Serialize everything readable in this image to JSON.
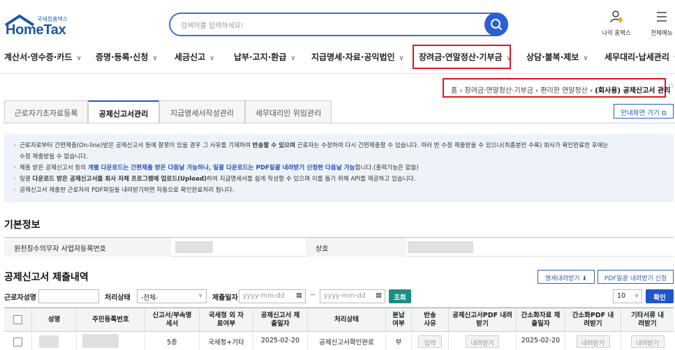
{
  "header": {
    "logo_sub": "국세청홈택스",
    "logo_main": "HomeTax",
    "search_placeholder": "검색어를 입력하세요!",
    "my_hometax": "나의 홈택스",
    "all_menu": "전체메뉴"
  },
  "nav": {
    "items": [
      {
        "label": "계산서·영수증·카드"
      },
      {
        "label": "증명·등록·신청"
      },
      {
        "label": "세금신고"
      },
      {
        "label": "납부·고지·환급"
      },
      {
        "label": "지급명세·자료·공익법인"
      },
      {
        "label": "장려금·연말정산·기부금"
      },
      {
        "label": "상담·불복·제보"
      },
      {
        "label": "세무대리·납세관리"
      }
    ]
  },
  "breadcrumb": {
    "home": "홈",
    "level1": "장려금·연말정산·기부금",
    "level2": "편리한 연말정산",
    "current": "(회사용) 공제신고서 관리"
  },
  "tabs": [
    {
      "label": "근로자기초자료등록"
    },
    {
      "label": "공제신고서관리"
    },
    {
      "label": "지급명세서작성관리"
    },
    {
      "label": "세무대리인 위임관리"
    }
  ],
  "guide_button": "안내화면 가기",
  "notice": {
    "l1a": "근로자로부터 간편제출(On-line)받은 공제신고서 등에 잘못이 있을 경우 그 사유를 기재하여 ",
    "l1b": "반송할 수 있으며",
    "l1c": " 근로자는 수정하여 다시 간편제출할 수 있습니다. 여러 번 수정 제출받을 수 있으나(최종분만 수록) 회사가 확인완료한 후에는",
    "l1d": "수정 제출받을 수 없습니다.",
    "l2a": "제출 받은 공제신고서 등의 ",
    "l2b": "개별 다운로드는 간편제출 받은 다음날 가능하나, 일괄 다운로드는 PDF일괄 내려받기 신청한 다음날 가능",
    "l2c": "합니다.(출력기능은 없음)",
    "l3a": "일괄 ",
    "l3b": "다운로드 받은 공제신고서를 회사 자체 프로그램에 업로드(Upload)",
    "l3c": "하여 지급명세서를 쉽게 작성할 수 있으며 이를 돕기 위해 API를 제공하고 있습니다.",
    "l4": "공제신고서 제출한 근로자의 PDF파일을 내려받기하면 자동으로 확인완료처리 됩니다."
  },
  "basic_info": {
    "title": "기본정보",
    "bizno_label": "원천징수의무자 사업자등록번호",
    "name_label": "상호"
  },
  "submission": {
    "title": "공제신고서 제출내역",
    "detail_download": "명세내려받기",
    "pdf_bulk": "PDF일괄 내려받기 신청",
    "filter": {
      "worker_name_label": "근로자성명",
      "status_label": "처리상태",
      "status_value": "-전체-",
      "date_label": "제출일자",
      "date_placeholder_from": "yyyy-mm-dd",
      "date_tilde": "~",
      "date_placeholder_to": "yyyy-mm-dd",
      "search_button": "조회",
      "page_size": "10",
      "confirm_button": "확인"
    },
    "columns": [
      "",
      "성명",
      "주민등록번호",
      "신고서/부속명세서",
      "국세청 외 자료여부",
      "공제신고서 제출일자",
      "처리상태",
      "분납 여부",
      "반송 사유",
      "공제신고서PDF 내려받기",
      "간소화자료 제출일자",
      "간소화PDF 내려받기",
      "기타서류 내려받기"
    ],
    "rows": [
      {
        "forms": "5종",
        "external": "국세청+기타",
        "submit_date": "2025-02-20",
        "status": "공제신고서확인완료",
        "installment": "부",
        "return_reason": "입력",
        "pdf_download": "내려받기",
        "simplified_date": "2025-02-20",
        "simplified_pdf": "내려받기",
        "etc_docs": "내려받기"
      }
    ]
  },
  "colors": {
    "brand": "#1a56a6",
    "highlight_border": "#e0141d",
    "accent_blue": "#1f56c7",
    "search_teal": "#1a8e86"
  }
}
